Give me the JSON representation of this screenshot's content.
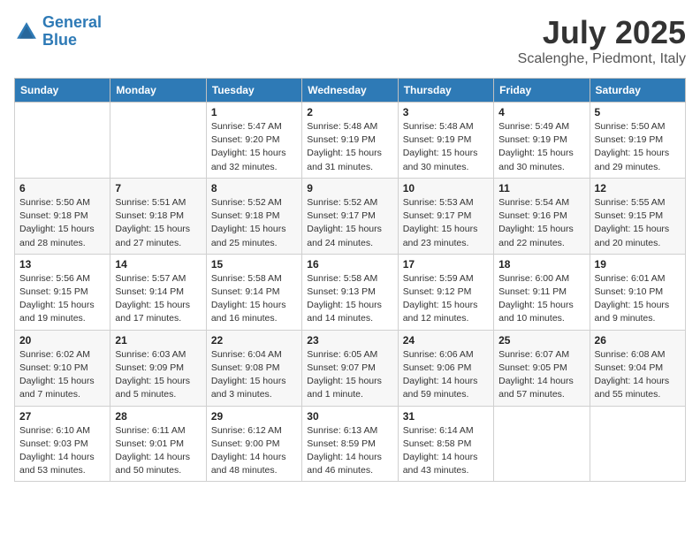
{
  "header": {
    "logo_line1": "General",
    "logo_line2": "Blue",
    "month_year": "July 2025",
    "location": "Scalenghe, Piedmont, Italy"
  },
  "weekdays": [
    "Sunday",
    "Monday",
    "Tuesday",
    "Wednesday",
    "Thursday",
    "Friday",
    "Saturday"
  ],
  "weeks": [
    [
      {
        "day": "",
        "info": ""
      },
      {
        "day": "",
        "info": ""
      },
      {
        "day": "1",
        "info": "Sunrise: 5:47 AM\nSunset: 9:20 PM\nDaylight: 15 hours\nand 32 minutes."
      },
      {
        "day": "2",
        "info": "Sunrise: 5:48 AM\nSunset: 9:19 PM\nDaylight: 15 hours\nand 31 minutes."
      },
      {
        "day": "3",
        "info": "Sunrise: 5:48 AM\nSunset: 9:19 PM\nDaylight: 15 hours\nand 30 minutes."
      },
      {
        "day": "4",
        "info": "Sunrise: 5:49 AM\nSunset: 9:19 PM\nDaylight: 15 hours\nand 30 minutes."
      },
      {
        "day": "5",
        "info": "Sunrise: 5:50 AM\nSunset: 9:19 PM\nDaylight: 15 hours\nand 29 minutes."
      }
    ],
    [
      {
        "day": "6",
        "info": "Sunrise: 5:50 AM\nSunset: 9:18 PM\nDaylight: 15 hours\nand 28 minutes."
      },
      {
        "day": "7",
        "info": "Sunrise: 5:51 AM\nSunset: 9:18 PM\nDaylight: 15 hours\nand 27 minutes."
      },
      {
        "day": "8",
        "info": "Sunrise: 5:52 AM\nSunset: 9:18 PM\nDaylight: 15 hours\nand 25 minutes."
      },
      {
        "day": "9",
        "info": "Sunrise: 5:52 AM\nSunset: 9:17 PM\nDaylight: 15 hours\nand 24 minutes."
      },
      {
        "day": "10",
        "info": "Sunrise: 5:53 AM\nSunset: 9:17 PM\nDaylight: 15 hours\nand 23 minutes."
      },
      {
        "day": "11",
        "info": "Sunrise: 5:54 AM\nSunset: 9:16 PM\nDaylight: 15 hours\nand 22 minutes."
      },
      {
        "day": "12",
        "info": "Sunrise: 5:55 AM\nSunset: 9:15 PM\nDaylight: 15 hours\nand 20 minutes."
      }
    ],
    [
      {
        "day": "13",
        "info": "Sunrise: 5:56 AM\nSunset: 9:15 PM\nDaylight: 15 hours\nand 19 minutes."
      },
      {
        "day": "14",
        "info": "Sunrise: 5:57 AM\nSunset: 9:14 PM\nDaylight: 15 hours\nand 17 minutes."
      },
      {
        "day": "15",
        "info": "Sunrise: 5:58 AM\nSunset: 9:14 PM\nDaylight: 15 hours\nand 16 minutes."
      },
      {
        "day": "16",
        "info": "Sunrise: 5:58 AM\nSunset: 9:13 PM\nDaylight: 15 hours\nand 14 minutes."
      },
      {
        "day": "17",
        "info": "Sunrise: 5:59 AM\nSunset: 9:12 PM\nDaylight: 15 hours\nand 12 minutes."
      },
      {
        "day": "18",
        "info": "Sunrise: 6:00 AM\nSunset: 9:11 PM\nDaylight: 15 hours\nand 10 minutes."
      },
      {
        "day": "19",
        "info": "Sunrise: 6:01 AM\nSunset: 9:10 PM\nDaylight: 15 hours\nand 9 minutes."
      }
    ],
    [
      {
        "day": "20",
        "info": "Sunrise: 6:02 AM\nSunset: 9:10 PM\nDaylight: 15 hours\nand 7 minutes."
      },
      {
        "day": "21",
        "info": "Sunrise: 6:03 AM\nSunset: 9:09 PM\nDaylight: 15 hours\nand 5 minutes."
      },
      {
        "day": "22",
        "info": "Sunrise: 6:04 AM\nSunset: 9:08 PM\nDaylight: 15 hours\nand 3 minutes."
      },
      {
        "day": "23",
        "info": "Sunrise: 6:05 AM\nSunset: 9:07 PM\nDaylight: 15 hours\nand 1 minute."
      },
      {
        "day": "24",
        "info": "Sunrise: 6:06 AM\nSunset: 9:06 PM\nDaylight: 14 hours\nand 59 minutes."
      },
      {
        "day": "25",
        "info": "Sunrise: 6:07 AM\nSunset: 9:05 PM\nDaylight: 14 hours\nand 57 minutes."
      },
      {
        "day": "26",
        "info": "Sunrise: 6:08 AM\nSunset: 9:04 PM\nDaylight: 14 hours\nand 55 minutes."
      }
    ],
    [
      {
        "day": "27",
        "info": "Sunrise: 6:10 AM\nSunset: 9:03 PM\nDaylight: 14 hours\nand 53 minutes."
      },
      {
        "day": "28",
        "info": "Sunrise: 6:11 AM\nSunset: 9:01 PM\nDaylight: 14 hours\nand 50 minutes."
      },
      {
        "day": "29",
        "info": "Sunrise: 6:12 AM\nSunset: 9:00 PM\nDaylight: 14 hours\nand 48 minutes."
      },
      {
        "day": "30",
        "info": "Sunrise: 6:13 AM\nSunset: 8:59 PM\nDaylight: 14 hours\nand 46 minutes."
      },
      {
        "day": "31",
        "info": "Sunrise: 6:14 AM\nSunset: 8:58 PM\nDaylight: 14 hours\nand 43 minutes."
      },
      {
        "day": "",
        "info": ""
      },
      {
        "day": "",
        "info": ""
      }
    ]
  ]
}
